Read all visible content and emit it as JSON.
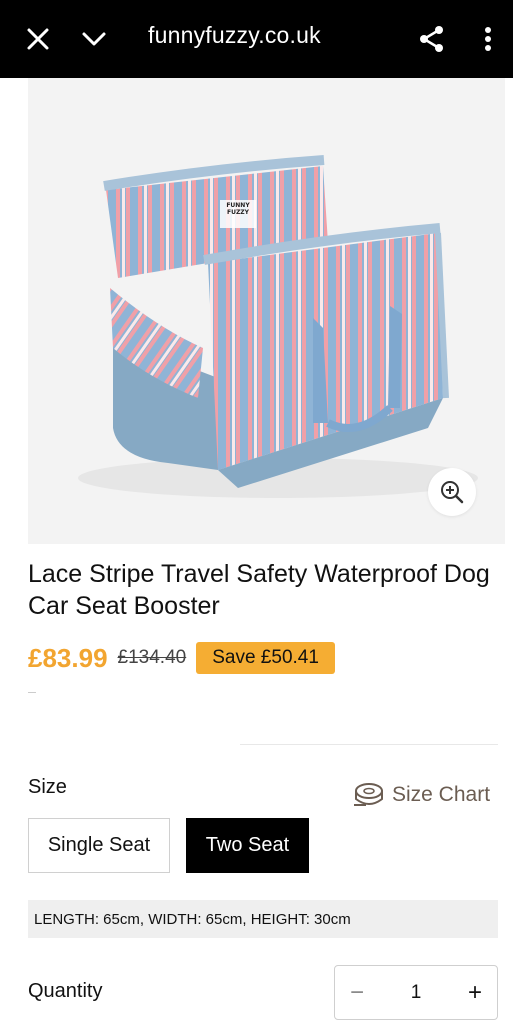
{
  "browser": {
    "url": "funnyfuzzy.co.uk",
    "icons": [
      "close-icon",
      "chevron-down-icon",
      "share-icon",
      "more-vertical-icon"
    ]
  },
  "product": {
    "image_logo_text": "FUNNY FUZZY",
    "title": "Lace Stripe Travel Safety Waterproof Dog Car Seat Booster",
    "price": "£83.99",
    "old_price": "£134.40",
    "save": "Save £50.41"
  },
  "size": {
    "label": "Size",
    "chart_label": "Size Chart",
    "options": [
      {
        "label": "Single Seat",
        "selected": false
      },
      {
        "label": "Two Seat",
        "selected": true
      }
    ],
    "dimensions": "LENGTH: 65cm, WIDTH: 65cm, HEIGHT: 30cm"
  },
  "quantity": {
    "label": "Quantity",
    "minus": "−",
    "value": "1",
    "plus": "+"
  },
  "colors": {
    "accent": "#f2a530",
    "badge": "#f5ad33",
    "stripe_blue": "#8fb4d6",
    "stripe_pink": "#f0a0a8"
  }
}
